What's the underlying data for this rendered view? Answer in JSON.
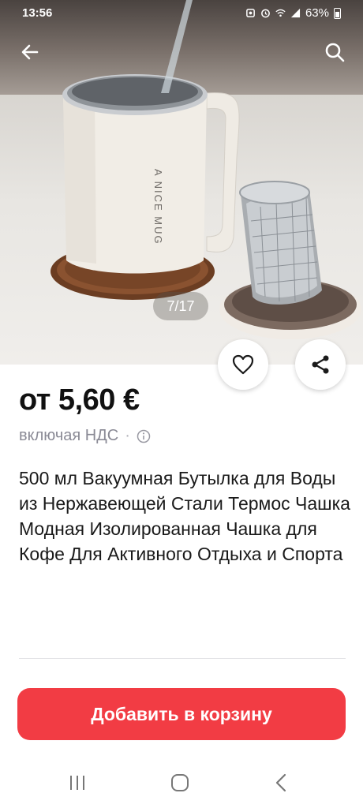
{
  "status_bar": {
    "time": "13:56",
    "battery": "63%",
    "icons": [
      "screenshot-icon",
      "alarm-icon",
      "wifi-icon",
      "signal-icon",
      "battery-icon"
    ]
  },
  "hero": {
    "image_counter": "7/17",
    "mug_lettering": "A NICE MUG",
    "icons": [
      "back-arrow-icon",
      "search-icon",
      "heart-icon",
      "share-icon"
    ]
  },
  "product": {
    "price": "от 5,60 €",
    "vat_label": "включая НДС",
    "vat_separator": "·",
    "title": "500 мл Вакуумная Бутылка для Воды из Нержавеющей Стали Термос Чашка Модная Изолированная Чашка для Кофе Для Активного Отдыха и Спорта"
  },
  "actions": {
    "add_to_cart": "Добавить в корзину"
  },
  "colors": {
    "accent": "#f23c44",
    "muted_text": "#8a8a95"
  }
}
